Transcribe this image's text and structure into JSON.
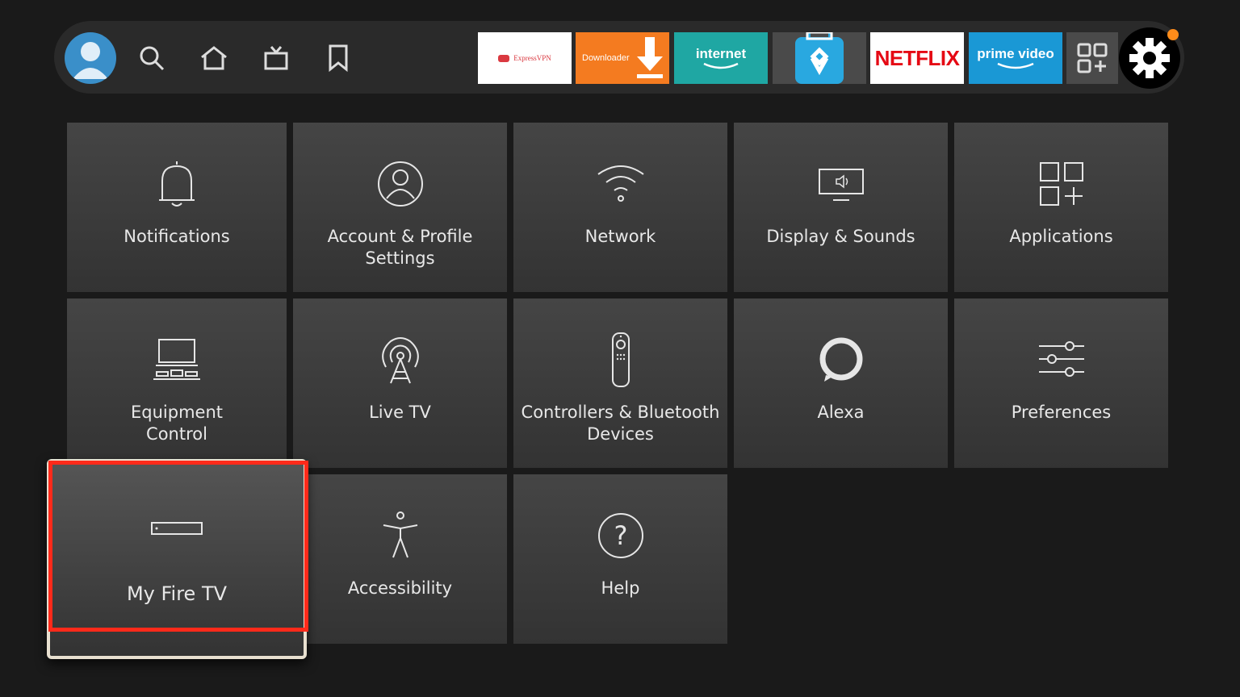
{
  "top_bar": {
    "apps": [
      {
        "name": "ExpressVPN",
        "label": "ExpressVPN",
        "bg": "#ffffff",
        "color": "#da3940"
      },
      {
        "name": "Downloader",
        "label": "Downloader",
        "bg": "#f47b20",
        "color": "#ffffff"
      },
      {
        "name": "internet",
        "label": "internet",
        "bg": "#1fa7a3",
        "color": "#ffffff"
      },
      {
        "name": "app-store-alt",
        "label": "",
        "bg": "#4a4a4a",
        "color": "#29a8e0"
      },
      {
        "name": "Netflix",
        "label": "NETFLIX",
        "bg": "#ffffff",
        "color": "#e50914"
      },
      {
        "name": "Prime Video",
        "label": "prime video",
        "bg": "#1a98d5",
        "color": "#ffffff"
      }
    ],
    "icons": [
      "avatar-icon",
      "search-icon",
      "home-icon",
      "live-tv-icon",
      "bookmark-icon",
      "apps-grid-icon",
      "settings-gear-icon"
    ],
    "notification_dot_color": "#ff8c1a"
  },
  "settings_tiles": [
    {
      "label": "Notifications",
      "icon": "bell-icon"
    },
    {
      "label": "Account & Profile Settings",
      "icon": "person-icon"
    },
    {
      "label": "Network",
      "icon": "wifi-icon"
    },
    {
      "label": "Display & Sounds",
      "icon": "display-speaker-icon"
    },
    {
      "label": "Applications",
      "icon": "applications-icon"
    },
    {
      "label": "Equipment Control",
      "icon": "equipment-icon"
    },
    {
      "label": "Live TV",
      "icon": "antenna-icon"
    },
    {
      "label": "Controllers & Bluetooth Devices",
      "icon": "remote-icon"
    },
    {
      "label": "Alexa",
      "icon": "alexa-icon"
    },
    {
      "label": "Preferences",
      "icon": "sliders-icon"
    },
    {
      "label": "My Fire TV",
      "icon": "fire-tv-device-icon",
      "focused": true
    },
    {
      "label": "Accessibility",
      "icon": "accessibility-icon"
    },
    {
      "label": "Help",
      "icon": "help-icon"
    }
  ],
  "highlight_color": "#ff2a1a"
}
